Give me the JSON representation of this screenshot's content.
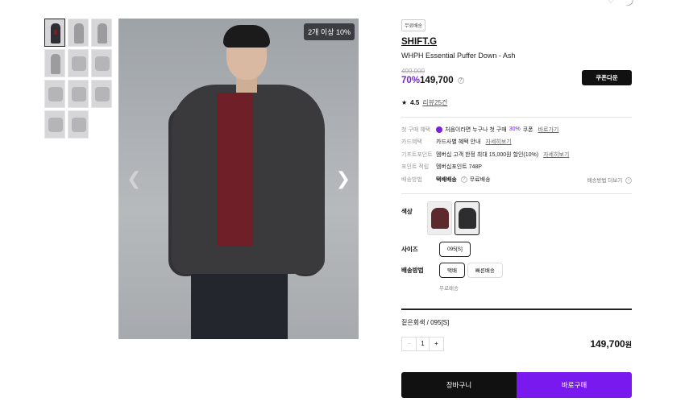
{
  "gallery": {
    "badge": "2개 이상 10%",
    "prev_icon": "chevron-left-icon",
    "next_icon": "chevron-right-icon",
    "thumbnail_count": 11
  },
  "product": {
    "tag": "무료배송",
    "brand": "SHIFT.G",
    "name": "WHPH Essential Puffer Down - Ash",
    "original_price": "499,000",
    "discount": "70%",
    "price": "149,700",
    "coupon_button": "쿠폰다운",
    "rating": "4.5",
    "review_link": "리뷰25건"
  },
  "benefits": [
    {
      "key": "첫 구매 혜택",
      "pre": "처음이라면 누구나 첫 구매",
      "highlight": "30%",
      "post": "쿠폰",
      "link": "바로가기"
    },
    {
      "key": "카드혜택",
      "value": "카드사별 혜택 안내",
      "link": "자세히보기"
    },
    {
      "key": "기프트포인트",
      "value": "멤버십 고객 한정 최대 15,000원 할인(10%)",
      "link": "자세히보기"
    },
    {
      "key": "포인트 적립",
      "value": "멤버십포인트 748P"
    },
    {
      "key": "배송방법",
      "bold": "택배배송",
      "value": "무료배송",
      "more": "배송방법 더보기"
    }
  ],
  "options": {
    "color_label": "색상",
    "size_label": "사이즈",
    "size_value": "095[S]",
    "shipping_label": "배송방법",
    "shipping_options": [
      "택배",
      "빠른배송"
    ],
    "shipping_note": "무료배송"
  },
  "selection": {
    "label": "짙은회색 / 095[S]",
    "quantity": "1",
    "total": "149,700",
    "currency": "원"
  },
  "actions": {
    "cart": "장바구니",
    "buy": "바로구매"
  },
  "colors": {
    "accent": "#7a18f0",
    "dark": "#111111"
  }
}
